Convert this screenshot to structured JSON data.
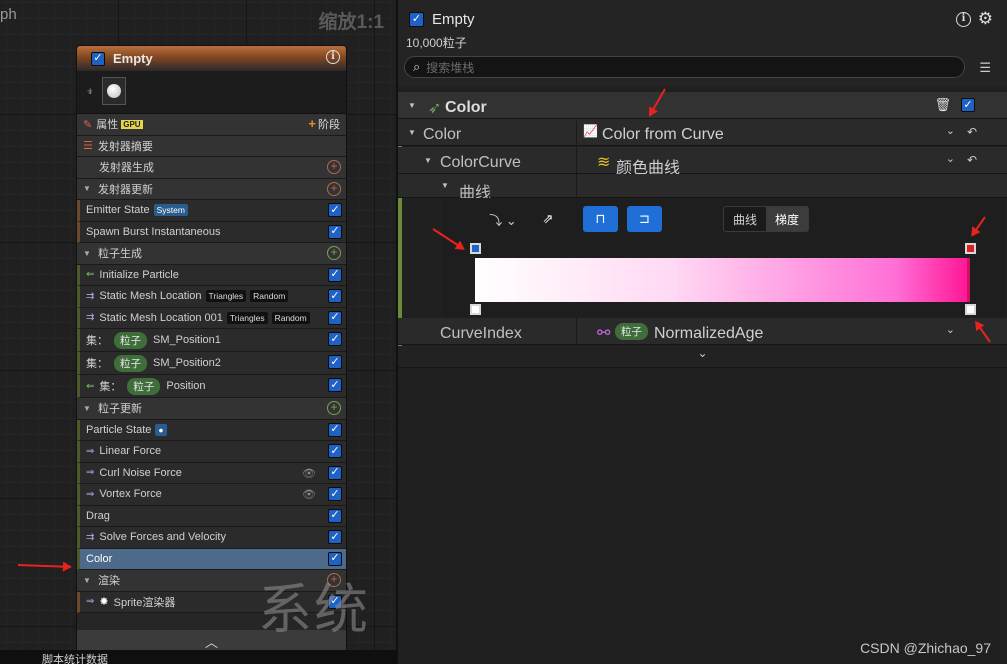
{
  "graph": {
    "tab_label": "ph",
    "zoom_label": "缩放1:1",
    "watermark": "系统",
    "bottom_label": "脚本统计数据"
  },
  "node": {
    "title": "Empty",
    "properties_label": "属性",
    "gpu_tag": "GPU",
    "stage_label": "阶段",
    "sections": {
      "emitter_summary": "发射器摘要",
      "emitter_spawn": "发射器生成",
      "emitter_update": "发射器更新",
      "particle_spawn": "粒子生成",
      "particle_update": "粒子更新",
      "render": "渲染"
    },
    "modules": {
      "emitter_state": "Emitter State",
      "emitter_state_tag": "System",
      "spawn_burst": "Spawn Burst Instantaneous",
      "init_particle": "Initialize Particle",
      "sml1": "Static Mesh Location",
      "sml1_tag1": "Triangles",
      "sml1_tag2": "Random",
      "sml2": "Static Mesh Location 001",
      "sml2_tag1": "Triangles",
      "sml2_tag2": "Random",
      "set_label": "集：",
      "particle_pill": "粒子",
      "sm_pos1": "SM_Position1",
      "sm_pos2": "SM_Position2",
      "position": "Position",
      "particle_state": "Particle State",
      "linear_force": "Linear Force",
      "curl_noise": "Curl Noise Force",
      "vortex_force": "Vortex Force",
      "drag": "Drag",
      "solve_forces": "Solve Forces and Velocity",
      "color": "Color",
      "sprite_renderer": "Sprite渲染器"
    }
  },
  "details": {
    "title": "Empty",
    "subtitle": "10,000粒子",
    "search_placeholder": "搜索堆栈",
    "category": "Color",
    "rows": {
      "color_label": "Color",
      "color_value": "Color from Curve",
      "colorcurve_label": "ColorCurve",
      "colorcurve_value": "颜色曲线",
      "curve_label": "曲线",
      "curveindex_label": "CurveIndex",
      "curveindex_pill": "粒子",
      "curveindex_value": "NormalizedAge"
    },
    "toggle": {
      "curve": "曲线",
      "gradient": "梯度"
    },
    "gradient": {
      "start_color": "#ffffff",
      "end_color": "#ff1493"
    }
  },
  "credit": "CSDN @Zhichao_97"
}
